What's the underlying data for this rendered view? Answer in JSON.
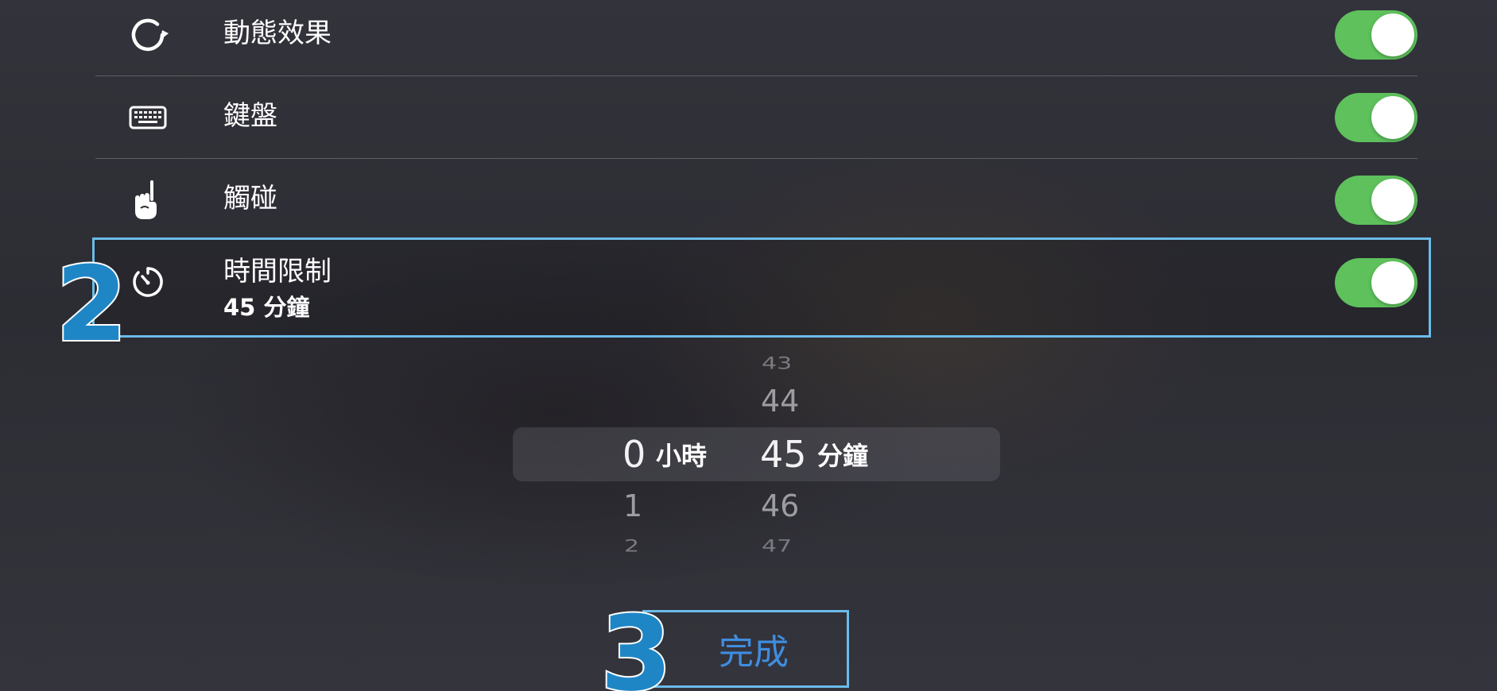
{
  "settings": {
    "rows": [
      {
        "label": "動態效果",
        "icon": "rotate-icon",
        "enabled": true
      },
      {
        "label": "鍵盤",
        "icon": "keyboard-icon",
        "enabled": true
      },
      {
        "label": "觸碰",
        "icon": "touch-hand-icon",
        "enabled": true
      },
      {
        "label": "時間限制",
        "sublabel": "45 分鐘",
        "icon": "timer-icon",
        "enabled": true
      }
    ]
  },
  "picker": {
    "hours": {
      "above": [],
      "selected": "0",
      "below": [
        "1",
        "2"
      ],
      "unit": "小時"
    },
    "minutes": {
      "above": [
        "43",
        "44"
      ],
      "selected": "45",
      "below": [
        "46",
        "47"
      ],
      "unit": "分鐘"
    }
  },
  "done_button": {
    "label": "完成"
  },
  "annotations": {
    "step_2": "2",
    "step_3": "3"
  },
  "colors": {
    "toggle_on": "#5ec15c",
    "highlight_border": "#6bbce9",
    "step_number_fill": "#1f86c6",
    "done_text": "#3f8de0"
  }
}
